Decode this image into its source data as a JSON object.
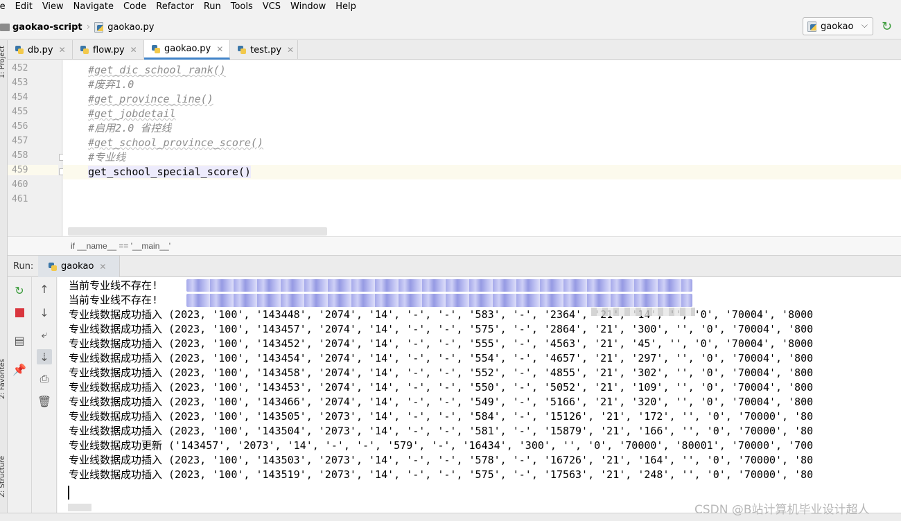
{
  "menu": [
    "le",
    "Edit",
    "View",
    "Navigate",
    "Code",
    "Refactor",
    "Run",
    "Tools",
    "VCS",
    "Window",
    "Help"
  ],
  "nav": {
    "project": "gaokao-script",
    "file": "gaokao.py",
    "run_config": "gaokao"
  },
  "tabs": [
    {
      "label": "db.py"
    },
    {
      "label": "flow.py"
    },
    {
      "label": "gaokao.py"
    },
    {
      "label": "test.py"
    }
  ],
  "editor": {
    "line_numbers": [
      "452",
      "453",
      "454",
      "455",
      "456",
      "457",
      "458",
      "459",
      "460",
      "461"
    ],
    "lines": [
      "#get_dic_school_rank()",
      "#废弃1.0",
      "#get_province_line()",
      "#get_jobdetail",
      "#启用2.0 省控线",
      "#get_school_province_score()",
      "#专业线",
      "get_school_special_score()",
      "",
      ""
    ],
    "breadcrumb": "if __name__ == '__main__'"
  },
  "run": {
    "label": "Run:",
    "tab": "gaokao",
    "output": [
      "当前专业线不存在!",
      "当前专业线不存在!",
      "专业线数据成功插入 (2023, '100', '143448', '2074', '14', '-', '-', '583', '-', '2364', '21', '14', '', '0', '70004', '8000",
      "专业线数据成功插入 (2023, '100', '143457', '2074', '14', '-', '-', '575', '-', '2864', '21', '300', '', '0', '70004', '800",
      "专业线数据成功插入 (2023, '100', '143452', '2074', '14', '-', '-', '555', '-', '4563', '21', '45', '', '0', '70004', '8000",
      "专业线数据成功插入 (2023, '100', '143454', '2074', '14', '-', '-', '554', '-', '4657', '21', '297', '', '0', '70004', '800",
      "专业线数据成功插入 (2023, '100', '143458', '2074', '14', '-', '-', '552', '-', '4855', '21', '302', '', '0', '70004', '800",
      "专业线数据成功插入 (2023, '100', '143453', '2074', '14', '-', '-', '550', '-', '5052', '21', '109', '', '0', '70004', '800",
      "专业线数据成功插入 (2023, '100', '143466', '2074', '14', '-', '-', '549', '-', '5166', '21', '320', '', '0', '70004', '800",
      "专业线数据成功插入 (2023, '100', '143505', '2073', '14', '-', '-', '584', '-', '15126', '21', '172', '', '0', '70000', '80",
      "专业线数据成功插入 (2023, '100', '143504', '2073', '14', '-', '-', '581', '-', '15879', '21', '166', '', '0', '70000', '80",
      "专业线数据成功更新 ('143457', '2073', '14', '-', '-', '579', '-', '16434', '300', '', '0', '70000', '80001', '70000', '700",
      "专业线数据成功插入 (2023, '100', '143503', '2073', '14', '-', '-', '578', '-', '16726', '21', '164', '', '0', '70000', '80",
      "专业线数据成功插入 (2023, '100', '143519', '2073', '14', '-', '-', '575', '-', '17563', '21', '248', '', '0', '70000', '80"
    ]
  },
  "watermark": "CSDN @B站计算机毕业设计超人",
  "icons": {
    "rerun": "rerun-icon",
    "stop": "stop-icon",
    "up": "arrow-up-icon",
    "down": "arrow-down-icon",
    "wrap": "soft-wrap-icon",
    "scroll_end": "scroll-to-end-icon",
    "print": "print-icon",
    "trash": "trash-icon",
    "layout": "layout-icon",
    "pin": "pin-icon"
  },
  "colors": {
    "accent": "#4083c9",
    "run_green": "#3a9b3a",
    "stop_red": "#d9363e",
    "comment": "#8c8c8c"
  }
}
